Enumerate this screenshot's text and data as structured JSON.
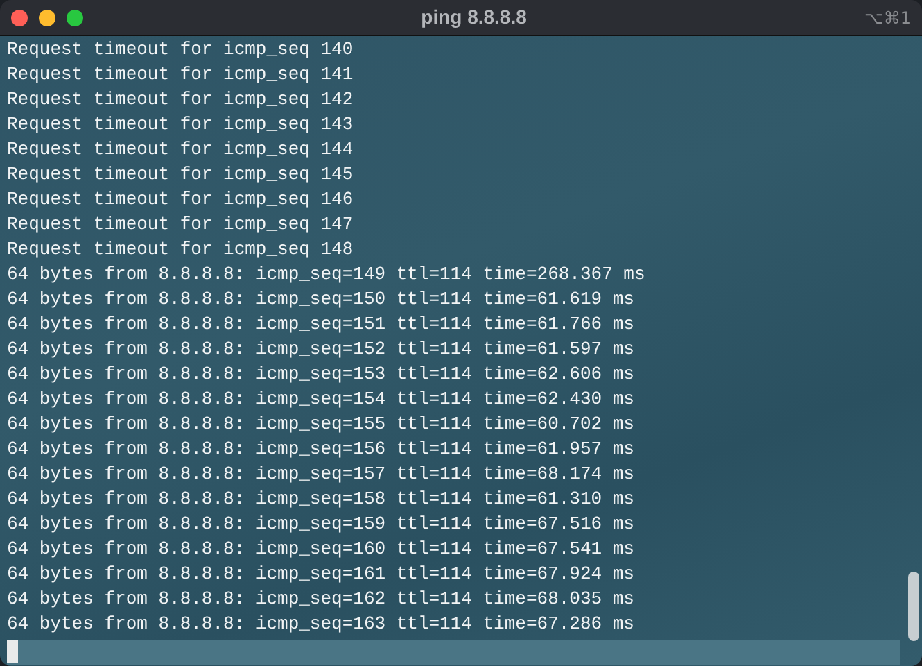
{
  "window": {
    "title": "ping 8.8.8.8",
    "shortcut": "⌥⌘1"
  },
  "lines": [
    "Request timeout for icmp_seq 140",
    "Request timeout for icmp_seq 141",
    "Request timeout for icmp_seq 142",
    "Request timeout for icmp_seq 143",
    "Request timeout for icmp_seq 144",
    "Request timeout for icmp_seq 145",
    "Request timeout for icmp_seq 146",
    "Request timeout for icmp_seq 147",
    "Request timeout for icmp_seq 148",
    "64 bytes from 8.8.8.8: icmp_seq=149 ttl=114 time=268.367 ms",
    "64 bytes from 8.8.8.8: icmp_seq=150 ttl=114 time=61.619 ms",
    "64 bytes from 8.8.8.8: icmp_seq=151 ttl=114 time=61.766 ms",
    "64 bytes from 8.8.8.8: icmp_seq=152 ttl=114 time=61.597 ms",
    "64 bytes from 8.8.8.8: icmp_seq=153 ttl=114 time=62.606 ms",
    "64 bytes from 8.8.8.8: icmp_seq=154 ttl=114 time=62.430 ms",
    "64 bytes from 8.8.8.8: icmp_seq=155 ttl=114 time=60.702 ms",
    "64 bytes from 8.8.8.8: icmp_seq=156 ttl=114 time=61.957 ms",
    "64 bytes from 8.8.8.8: icmp_seq=157 ttl=114 time=68.174 ms",
    "64 bytes from 8.8.8.8: icmp_seq=158 ttl=114 time=61.310 ms",
    "64 bytes from 8.8.8.8: icmp_seq=159 ttl=114 time=67.516 ms",
    "64 bytes from 8.8.8.8: icmp_seq=160 ttl=114 time=67.541 ms",
    "64 bytes from 8.8.8.8: icmp_seq=161 ttl=114 time=67.924 ms",
    "64 bytes from 8.8.8.8: icmp_seq=162 ttl=114 time=68.035 ms",
    "64 bytes from 8.8.8.8: icmp_seq=163 ttl=114 time=67.286 ms"
  ]
}
